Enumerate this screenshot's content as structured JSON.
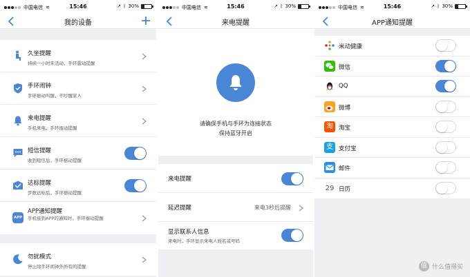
{
  "status": {
    "carrier": "中国电信",
    "time": "15:46",
    "battery": "30%",
    "battery_level": 0.3
  },
  "colors": {
    "accent": "#4a86d6",
    "orange": "#f0a030",
    "green": "#44b549",
    "wechat": "#2dc100",
    "weibo_red": "#e6162d",
    "taobao": "#ff5000",
    "alipay": "#1aa0e8"
  },
  "panel1": {
    "title": "我的设备",
    "items": [
      {
        "title": "久坐提醒",
        "subtitle": "持续一小时未活动，手环震动提醒",
        "control": "chevron",
        "icon": "sitting-person-icon"
      },
      {
        "title": "手环闹钟",
        "subtitle": "手环振动叫醒，不吵醒家人",
        "control": "chevron",
        "icon": "alarm-shield-icon"
      },
      {
        "title": "来电提醒",
        "subtitle": "手机来电，手环振动提醒",
        "control": "chevron",
        "icon": "bell-icon"
      },
      {
        "title": "短信提醒",
        "subtitle": "收到短信后，手环振动提醒",
        "control": "toggle",
        "on": true,
        "icon": "message-icon"
      },
      {
        "title": "达标提醒",
        "subtitle": "步数达标后，手环振动提醒",
        "control": "toggle",
        "on": true,
        "icon": "goal-envelope-icon"
      },
      {
        "title": "APP通知提醒",
        "subtitle": "手机接到APP的通知时，手环振动提醒",
        "control": "chevron",
        "icon": "app-icon",
        "icon_text": "APP"
      }
    ],
    "dnd": {
      "title": "勿扰模式",
      "subtitle": "停止除手环闹钟外所有的提醒",
      "icon": "moon-icon"
    }
  },
  "panel2": {
    "title": "来电提醒",
    "hint_line1": "请确保手机与手环为连接状态",
    "hint_line2": "保持蓝牙开启",
    "call_reminder": {
      "label": "来电提醒",
      "on": true
    },
    "delay": {
      "label": "延迟提醒",
      "value": "来电3秒后提醒"
    },
    "show_contact": {
      "label": "显示联系人信息",
      "subtitle": "来电时，手环显示来电人姓名或号码",
      "on": true
    }
  },
  "panel3": {
    "title": "APP通知提醒",
    "apps": [
      {
        "name": "米动健康",
        "on": false,
        "icon": "midong-health-icon"
      },
      {
        "name": "微信",
        "on": true,
        "icon": "wechat-icon"
      },
      {
        "name": "QQ",
        "on": true,
        "icon": "qq-penguin-icon"
      },
      {
        "name": "微博",
        "on": false,
        "icon": "weibo-icon"
      },
      {
        "name": "淘宝",
        "on": false,
        "icon": "taobao-icon",
        "icon_text": "淘"
      },
      {
        "name": "支付宝",
        "on": false,
        "icon": "alipay-icon",
        "icon_text": "支"
      },
      {
        "name": "邮件",
        "on": false,
        "icon": "mail-icon"
      },
      {
        "name": "日历",
        "on": false,
        "icon": "calendar-icon",
        "icon_text": "29"
      }
    ]
  },
  "watermark": {
    "text": "什么值得买",
    "badge": "值"
  }
}
